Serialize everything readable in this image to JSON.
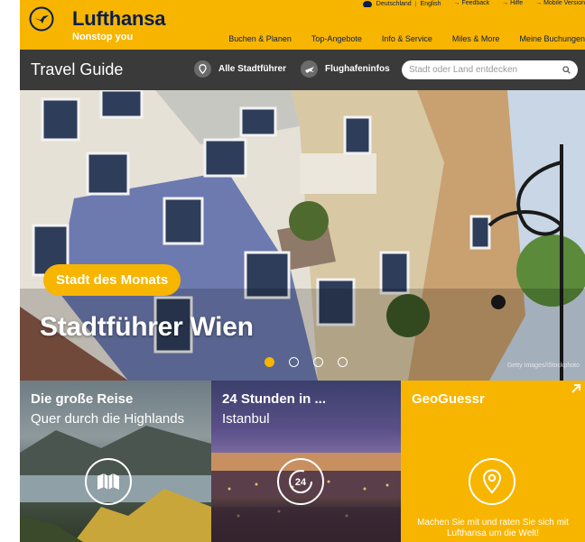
{
  "header": {
    "brand": "Lufthansa",
    "slogan": "Nonstop you",
    "utility": {
      "country": "Deutschland",
      "language": "English",
      "feedback": "→ Feedback",
      "help": "→ Hilfe",
      "mobile": "→ Mobile Version"
    },
    "nav": [
      "Buchen & Planen",
      "Top-Angebote",
      "Info & Service",
      "Miles & More",
      "Meine Buchungen"
    ]
  },
  "travel_guide": {
    "title": "Travel Guide",
    "all_city_guides": "Alle Stadtführer",
    "airport_info": "Flughafeninfos",
    "search_placeholder": "Stadt oder Land entdecken"
  },
  "hero": {
    "badge": "Stadt des Monats",
    "title": "Stadtführer Wien",
    "credit": "Getty Images/iStockphoto",
    "carousel": {
      "count": 4,
      "active": 1
    }
  },
  "tiles": [
    {
      "heading": "Die große Reise",
      "subtitle": "Quer durch die Highlands",
      "icon": "map-icon"
    },
    {
      "heading": "24 Stunden in ...",
      "subtitle": "Istanbul",
      "icon": "clock-24-icon",
      "icon_text": "24"
    },
    {
      "heading": "GeoGuessr",
      "text": "Machen Sie mit und raten Sie sich mit Lufthansa um die Welt!",
      "icon": "location-pin-icon"
    }
  ],
  "colors": {
    "brand_yellow": "#f7b500",
    "navy": "#0a1e4c",
    "dark_bar": "#3a3a3a"
  }
}
